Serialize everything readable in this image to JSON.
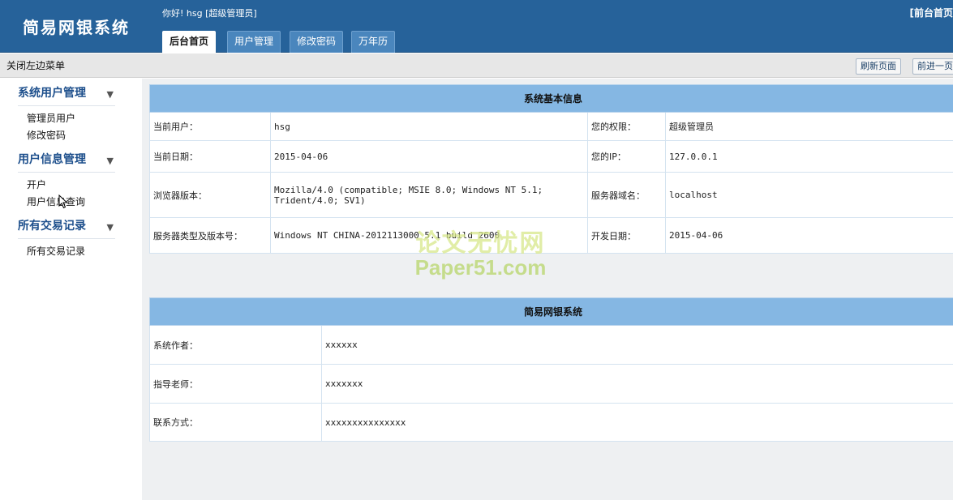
{
  "header": {
    "logo": "简易网银系统",
    "welcome": "你好! hsg [超级管理员]",
    "top_link": "[前台首页"
  },
  "tabs": [
    {
      "label": "后台首页",
      "active": true
    },
    {
      "label": "用户管理",
      "active": false
    },
    {
      "label": "修改密码",
      "active": false
    },
    {
      "label": "万年历",
      "active": false
    }
  ],
  "toolbar": {
    "close_menu": "关闭左边菜单",
    "refresh": "刷新页面",
    "forward": "前进一页"
  },
  "sidebar": {
    "groups": [
      {
        "title": "系统用户管理",
        "arrow": "▼",
        "items": [
          "管理员用户",
          "修改密码"
        ]
      },
      {
        "title": "用户信息管理",
        "arrow": "▼",
        "items": [
          "开户",
          "用户信息查询"
        ]
      },
      {
        "title": "所有交易记录",
        "arrow": "▼",
        "items": [
          "所有交易记录"
        ]
      }
    ]
  },
  "system_info": {
    "title": "系统基本信息",
    "rows": [
      {
        "label1": "当前用户：",
        "value1": "hsg",
        "label2": "您的权限：",
        "value2": "超级管理员"
      },
      {
        "label1": "当前日期：",
        "value1": "2015-04-06",
        "label2": "您的IP：",
        "value2": "127.0.0.1"
      },
      {
        "label1": "浏览器版本：",
        "value1": "Mozilla/4.0 (compatible; MSIE 8.0; Windows NT 5.1; Trident/4.0; SV1)",
        "label2": "服务器域名：",
        "value2": "localhost"
      },
      {
        "label1": "服务器类型及版本号：",
        "value1": "Windows NT CHINA-2012113000 5.1 build 2600",
        "label2": "开发日期：",
        "value2": "2015-04-06"
      }
    ]
  },
  "about": {
    "title": "简易网银系统",
    "rows": [
      {
        "label": "系统作者：",
        "value": "xxxxxx"
      },
      {
        "label": "指导老师：",
        "value": "xxxxxxx"
      },
      {
        "label": "联系方式：",
        "value": "xxxxxxxxxxxxxxx"
      }
    ]
  },
  "watermark": {
    "cn": "论文无忧网",
    "en": "Paper51.com"
  },
  "colors": {
    "header_bg": "#26629a",
    "table_header_bg": "#85b7e3",
    "toolbar_bg": "#e7e7e7",
    "sidebar_title": "#1d4f8c"
  }
}
